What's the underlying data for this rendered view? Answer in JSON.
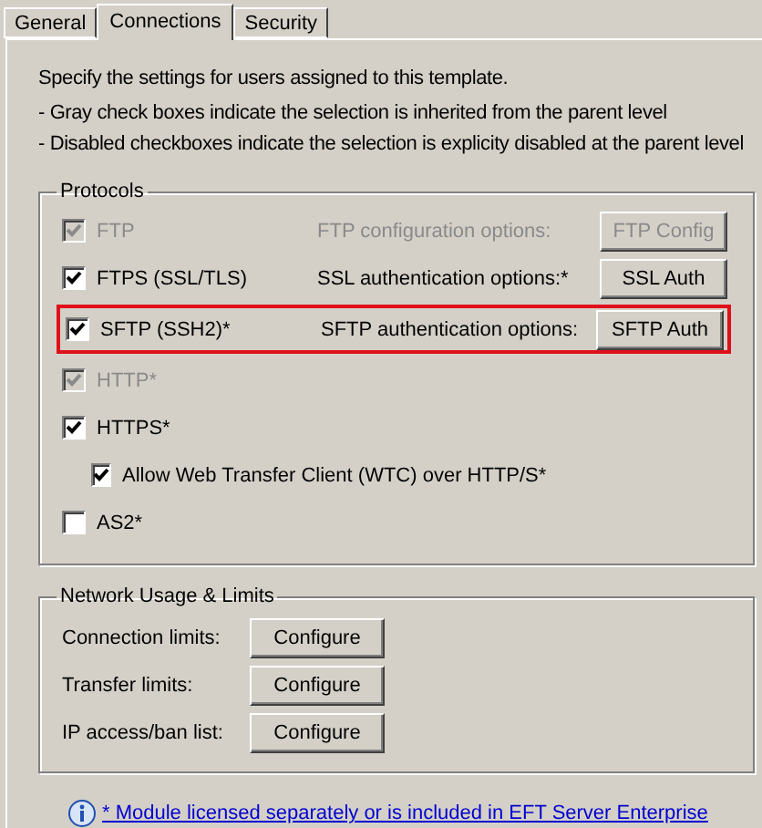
{
  "tabs": [
    {
      "label": "General",
      "selected": false
    },
    {
      "label": "Connections",
      "selected": true
    },
    {
      "label": "Security",
      "selected": false
    }
  ],
  "intro": [
    "Specify the settings for users assigned to this template.",
    "- Gray check boxes indicate the selection is inherited from the parent level",
    "- Disabled checkboxes indicate the selection is explicity disabled at the parent level"
  ],
  "protocols": {
    "title": "Protocols",
    "items": [
      {
        "label": "FTP",
        "checked": true,
        "disabled": true,
        "highlighted": false,
        "option": "FTP configuration options:",
        "button": "FTP Config"
      },
      {
        "label": "FTPS (SSL/TLS)",
        "checked": true,
        "disabled": false,
        "highlighted": false,
        "option": "SSL authentication options:*",
        "button": "SSL Auth"
      },
      {
        "label": "SFTP (SSH2)*",
        "checked": true,
        "disabled": false,
        "highlighted": true,
        "option": "SFTP authentication options:",
        "button": "SFTP Auth"
      },
      {
        "label": "HTTP*",
        "checked": true,
        "disabled": true,
        "highlighted": false
      },
      {
        "label": "HTTPS*",
        "checked": true,
        "disabled": false,
        "highlighted": false,
        "children": [
          {
            "label": "Allow Web Transfer Client  (WTC) over HTTP/S*",
            "checked": true,
            "disabled": false,
            "highlighted": false
          }
        ]
      },
      {
        "label": "AS2*",
        "checked": false,
        "disabled": false,
        "highlighted": false
      }
    ]
  },
  "network": {
    "title": "Network Usage & Limits",
    "rows": [
      {
        "label": "Connection limits:",
        "button": "Configure"
      },
      {
        "label": "Transfer limits:",
        "button": "Configure"
      },
      {
        "label": "IP access/ban list:",
        "button": "Configure"
      }
    ]
  },
  "footer_link": "* Module licensed separately or is included in EFT Server Enterprise"
}
